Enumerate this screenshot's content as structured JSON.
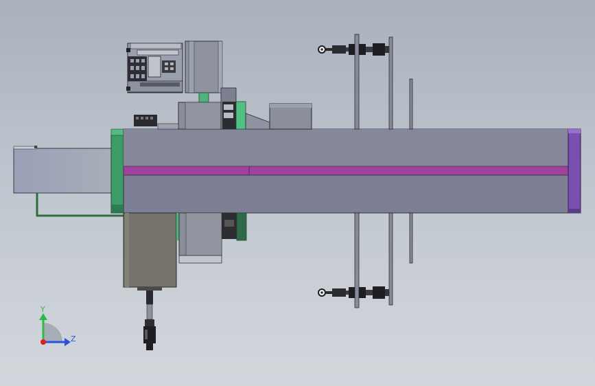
{
  "triad": {
    "y_label": "Y",
    "z_label": "Z",
    "y_color": "#2fb84a",
    "z_color": "#2a53d8",
    "origin_color": "#e02020"
  },
  "colors": {
    "beam_body": "#7d8095",
    "beam_top": "#85879b",
    "beam_stripe": "#a0429e",
    "end_cap": "#7b4fb0",
    "green_flange": "#3c9b66",
    "motor_body": "#76736d",
    "motor_cap": "#a6abb6",
    "dark_parts": "#2b2b2f",
    "steel": "#8c919d"
  }
}
